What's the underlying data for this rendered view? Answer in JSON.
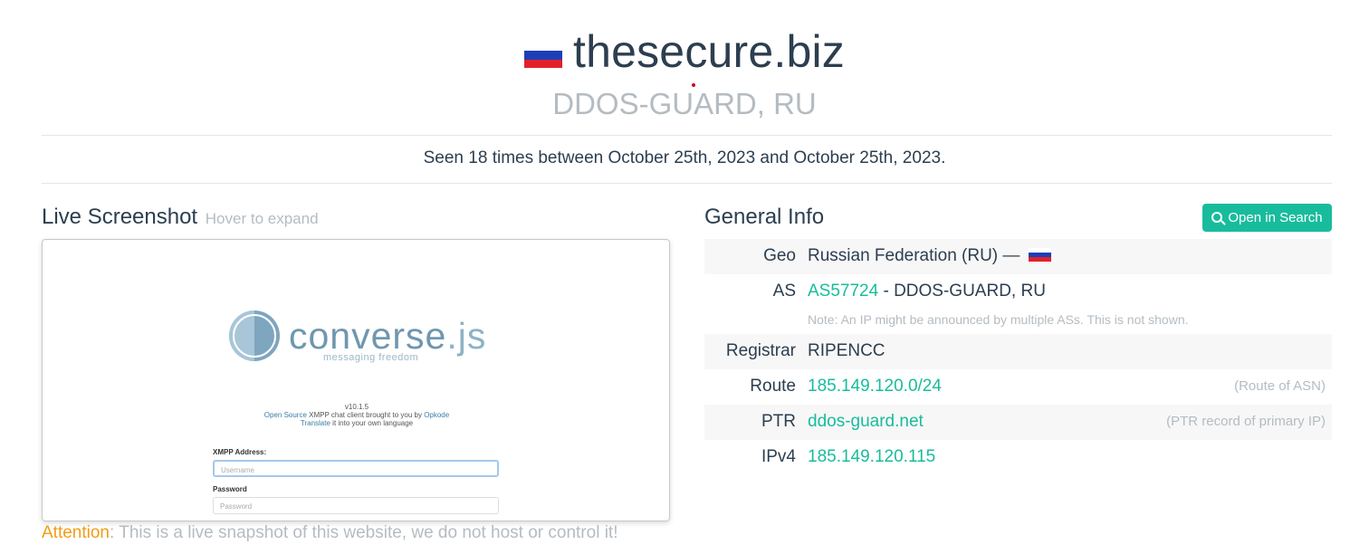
{
  "header": {
    "title": "thesecure.biz",
    "subtitle": "DDOS-GUARD, RU",
    "seen": "Seen 18 times between October 25th, 2023 and October 25th, 2023."
  },
  "screenshot": {
    "title": "Live Screenshot",
    "hint": "Hover to expand",
    "logo_main": "converse",
    "logo_ext": ".js",
    "logo_tagline": "messaging  freedom",
    "version": "v10.1.5",
    "line2_link1": "Open Source",
    "line2_mid": " XMPP chat client brought to you by ",
    "line2_link2": "Opkode",
    "line3_link": "Translate",
    "line3_rest": " it into your own language",
    "xmpp_label": "XMPP Address:",
    "username_placeholder": "Username",
    "password_label": "Password",
    "password_placeholder": "Password"
  },
  "attention": {
    "label": "Attention",
    "text": ": This is a live snapshot of this website, we do not host or control it!"
  },
  "general": {
    "title": "General Info",
    "open_button": "Open in Search",
    "rows": {
      "geo": {
        "key": "Geo",
        "value": "Russian Federation (RU) —"
      },
      "as": {
        "key": "AS",
        "link": "AS57724",
        "rest": " - DDOS-GUARD, RU",
        "note": "Note: An IP might be announced by multiple ASs. This is not shown."
      },
      "registrar": {
        "key": "Registrar",
        "value": "RIPENCC"
      },
      "route": {
        "key": "Route",
        "value": "185.149.120.0/24",
        "aside": "(Route of ASN)"
      },
      "ptr": {
        "key": "PTR",
        "value": "ddos-guard.net",
        "aside": "(PTR record of primary IP)"
      },
      "ipv4": {
        "key": "IPv4",
        "value": "185.149.120.115"
      }
    }
  },
  "colors": {
    "accent": "#18bc9c",
    "text": "#2c3e50",
    "muted": "#b4bcc2",
    "warning": "#f39c12"
  }
}
